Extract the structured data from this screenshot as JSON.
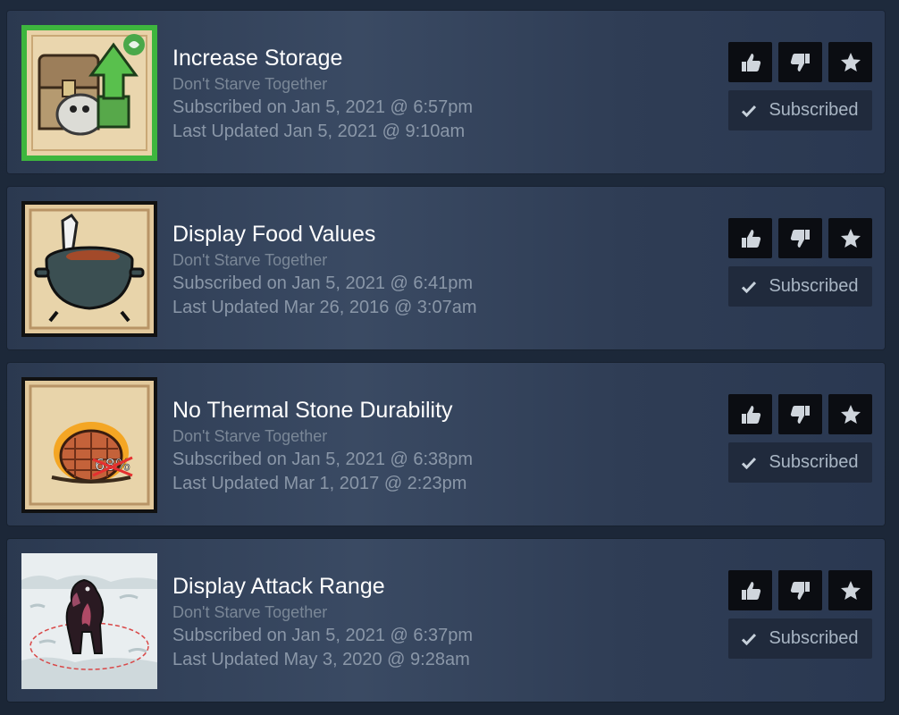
{
  "items": [
    {
      "title": "Increase Storage",
      "game": "Don't Starve Together",
      "subscribed": "Subscribed on Jan 5, 2021 @ 6:57pm",
      "updated": "Last Updated Jan 5, 2021 @ 9:10am",
      "button": "Subscribed",
      "thumb_icon": "storage-chest-icon",
      "thumb_border": "#3eb63e"
    },
    {
      "title": "Display Food Values",
      "game": "Don't Starve Together",
      "subscribed": "Subscribed on Jan 5, 2021 @ 6:41pm",
      "updated": "Last Updated Mar 26, 2016 @ 3:07am",
      "button": "Subscribed",
      "thumb_icon": "crock-pot-icon",
      "thumb_border": "#111111"
    },
    {
      "title": "No Thermal Stone Durability",
      "game": "Don't Starve Together",
      "subscribed": "Subscribed on Jan 5, 2021 @ 6:38pm",
      "updated": "Last Updated Mar 1, 2017 @ 2:23pm",
      "button": "Subscribed",
      "thumb_icon": "thermal-stone-icon",
      "thumb_border": "#111111"
    },
    {
      "title": "Display Attack Range",
      "game": "Don't Starve Together",
      "subscribed": "Subscribed on Jan 5, 2021 @ 6:37pm",
      "updated": "Last Updated May 3, 2020 @ 9:28am",
      "button": "Subscribed",
      "thumb_icon": "hound-snow-icon",
      "thumb_border": "none"
    }
  ],
  "colors": {
    "background": "#1b2838",
    "card": "#34445c",
    "title": "#ffffff",
    "meta": "#8a97a8",
    "vote_button": "#0b0d12"
  }
}
